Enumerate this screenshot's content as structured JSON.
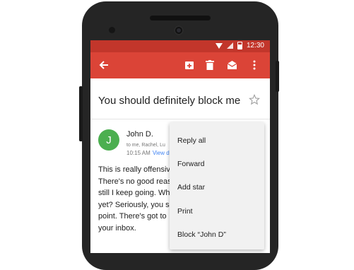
{
  "status_bar": {
    "time": "12:30",
    "icons": [
      "wifi-icon",
      "signal-icon",
      "battery-icon"
    ]
  },
  "app_bar": {
    "color": "#db4437",
    "icons": [
      "arrow-left-icon",
      "archive-icon",
      "trash-icon",
      "mark-unread-icon",
      "more-vert-icon"
    ]
  },
  "email": {
    "subject": "You should definitely block me",
    "sender": {
      "initial": "J",
      "name": "John D.",
      "recipients": "to me, Rachel, Lu",
      "time": "10:15 AM",
      "view_link": "View d",
      "avatar_color": "#4caf50"
    },
    "body_lines": [
      "This is really offensiv",
      "There's no good reas",
      "still I keep going. Wh",
      "yet? Seriously, you sh",
      "point. There's got to",
      "your inbox."
    ]
  },
  "overflow_menu": {
    "items": [
      "Reply all",
      "Forward",
      "Add star",
      "Print",
      "Block “John D”"
    ]
  }
}
